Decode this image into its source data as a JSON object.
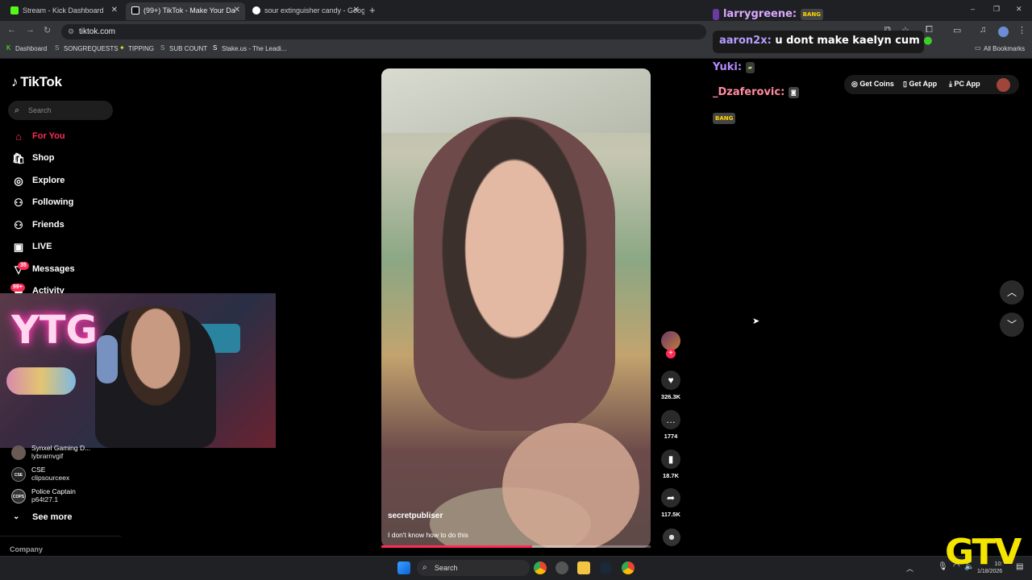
{
  "browser": {
    "tabs": [
      {
        "label": "Stream - Kick Dashboard",
        "color": "#53fc18"
      },
      {
        "label": "(99+) TikTok - Make Your Da",
        "color": "#000000"
      },
      {
        "label": "sour extinguisher candy - Goog",
        "color": "#4285f4"
      }
    ],
    "new_tab": "+",
    "url": "tiktok.com",
    "bookmarks": [
      "Dashboard",
      "SONGREQUESTS",
      "TIPPING",
      "SUB COUNT",
      "Stake.us - The Leadi..."
    ],
    "all_bookmarks": "All Bookmarks",
    "window_controls": [
      "–",
      "❐",
      "✕"
    ]
  },
  "tiktok": {
    "brand": "TikTok",
    "search_placeholder": "Search",
    "nav": [
      {
        "label": "For You",
        "icon": "home-icon",
        "glyph": "⌂"
      },
      {
        "label": "Shop",
        "icon": "shop-icon",
        "glyph": "🛍"
      },
      {
        "label": "Explore",
        "icon": "explore-icon",
        "glyph": "◎"
      },
      {
        "label": "Following",
        "icon": "following-icon",
        "glyph": "⚇"
      },
      {
        "label": "Friends",
        "icon": "friends-icon",
        "glyph": "⚇"
      },
      {
        "label": "LIVE",
        "icon": "live-icon",
        "glyph": "▣"
      },
      {
        "label": "Messages",
        "icon": "messages-icon",
        "glyph": "▽"
      },
      {
        "label": "Activity",
        "icon": "activity-icon",
        "glyph": "◆"
      }
    ],
    "messages_badge": "35",
    "activity_badge": "99+",
    "accounts": [
      {
        "name": "Synxel Gaming D...",
        "user": "lybrarnvgif",
        "avatar": ""
      },
      {
        "name": "CSE",
        "user": "clipsourceex",
        "avatar": "CSE"
      },
      {
        "name": "Police Captain",
        "user": "p64t27.1",
        "avatar": "COPS"
      }
    ],
    "see_more": "See more",
    "company": "Company",
    "top_actions": {
      "get_coins": "Get Coins",
      "get_app": "Get App",
      "pc_app": "PC App"
    },
    "video": {
      "username": "secretpubliser",
      "caption": "I don't know how to do this",
      "likes": "326.3K",
      "comments": "1774",
      "saves": "18.7K",
      "shares": "117.5K",
      "progress": 0.56
    }
  },
  "webcam": {
    "neon_sign": "YTG"
  },
  "chat": [
    {
      "user": "larrygreene:",
      "message": "BANG",
      "color": "#d9a9ff"
    },
    {
      "user": "aaron2x:",
      "message": "u dont make kaelyn cum",
      "color": "#b69dff"
    },
    {
      "user": "Yuki:",
      "message": "",
      "color": "#b48bff"
    },
    {
      "user": "_Dzaferovic:",
      "message": "",
      "color": "#ff8ca0"
    },
    {
      "user": "",
      "message": "BANG",
      "color": "#ffd400"
    }
  ],
  "taskbar": {
    "search": "Search",
    "time": "10:",
    "date": "1/18/2026"
  },
  "watermark": "GTV"
}
